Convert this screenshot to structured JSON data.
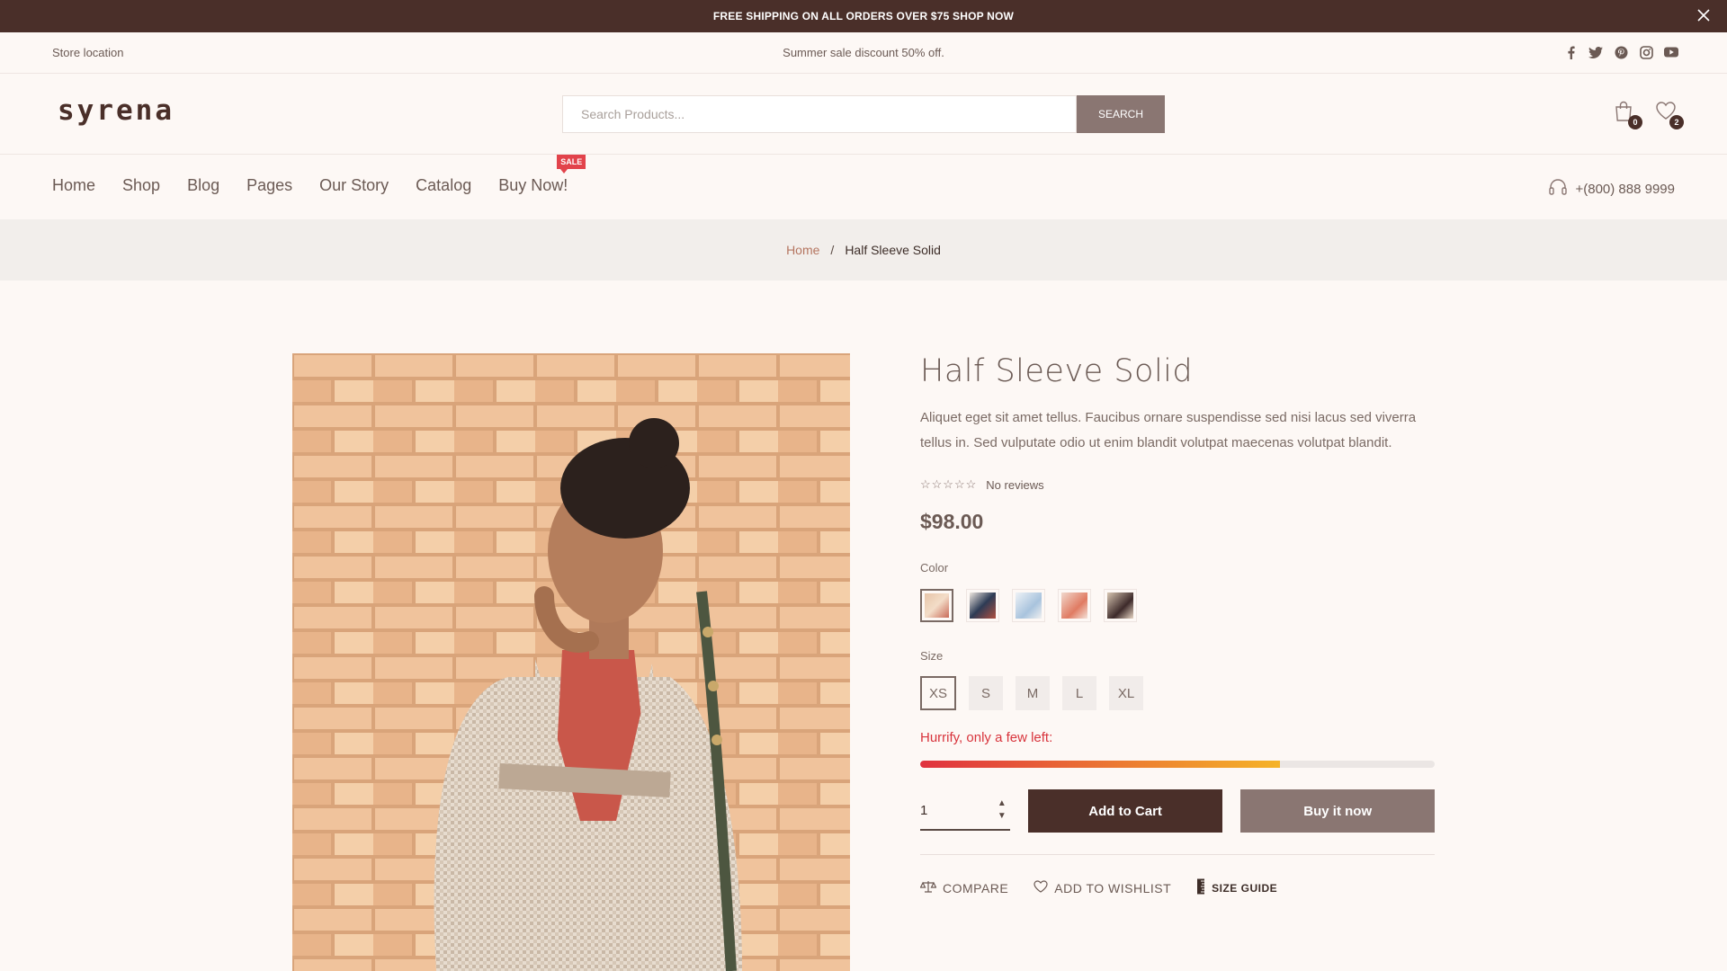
{
  "announcement": {
    "text": "FREE SHIPPING ON ALL ORDERS OVER $75 SHOP NOW",
    "close_icon": "close-icon"
  },
  "topbar": {
    "left": "Store location",
    "center": "Summer sale discount 50% off.",
    "social": [
      "facebook-icon",
      "twitter-icon",
      "pinterest-icon",
      "instagram-icon",
      "youtube-icon"
    ]
  },
  "header": {
    "logo": "syrena",
    "search": {
      "placeholder": "Search Products...",
      "button": "SEARCH"
    },
    "cart_count": "0",
    "wishlist_count": "2"
  },
  "nav": {
    "items": [
      "Home",
      "Shop",
      "Blog",
      "Pages",
      "Our Story",
      "Catalog",
      "Buy Now!"
    ],
    "sale_badge": "SALE",
    "phone": "+(800) 888 9999"
  },
  "breadcrumb": {
    "home": "Home",
    "separator": "/",
    "current": "Half Sleeve Solid"
  },
  "product": {
    "title": "Half Sleeve Solid",
    "description": "Aliquet eget sit amet tellus. Faucibus ornare suspendisse sed nisi lacus sed viverra tellus in. Sed vulputate odio ut enim blandit volutpat maecenas volutpat blandit.",
    "stars": "☆☆☆☆☆",
    "reviews": "No reviews",
    "price": "$98.00",
    "color_label": "Color",
    "colors": [
      "#d9b9a6",
      "#3b4a63",
      "#b9cde0",
      "#e0856f",
      "#6f5a4e"
    ],
    "size_label": "Size",
    "sizes": [
      "XS",
      "S",
      "M",
      "L",
      "XL"
    ],
    "selected_size": "XS",
    "stock_message": "Hurrify, only a few left:",
    "stock_level": 0.7,
    "quantity": "1",
    "add_to_cart": "Add to Cart",
    "buy_now": "Buy it now",
    "compare": "COMPARE",
    "wishlist": "ADD TO WISHLIST",
    "size_guide": "SIZE GUIDE"
  },
  "colors": {
    "brand": "#4a2f29",
    "accent": "#8a7672",
    "sale": "#e2434b"
  }
}
